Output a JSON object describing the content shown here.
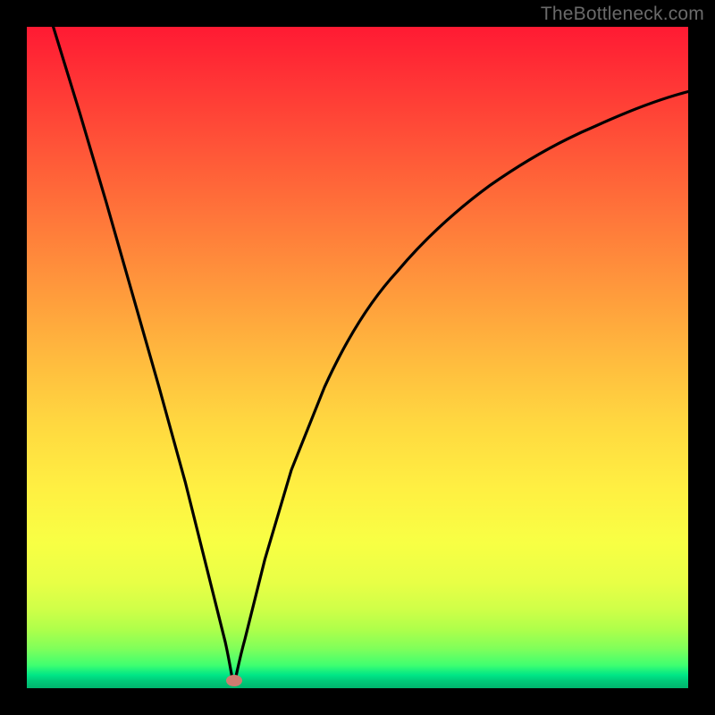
{
  "watermark": "TheBottleneck.com",
  "colors": {
    "background": "#000000",
    "gradient_top": "#ff1a33",
    "gradient_bottom": "#00b46e",
    "curve": "#000000",
    "dot": "#cf7b70"
  },
  "dot": {
    "x_frac": 0.313,
    "y_frac": 0.989
  },
  "chart_data": {
    "type": "line",
    "title": "",
    "xlabel": "",
    "ylabel": "",
    "xlim": [
      0,
      1
    ],
    "ylim": [
      0,
      1
    ],
    "note": "Axes are unlabeled; x and y values are normalized fractions of the plot area. y=1 is the top of the gradient (red), y=0 is the bottom (green). The curve is a V-shaped dip reaching ~0 near x≈0.31.",
    "series": [
      {
        "name": "curve",
        "x": [
          0.04,
          0.08,
          0.12,
          0.16,
          0.2,
          0.24,
          0.28,
          0.3,
          0.313,
          0.33,
          0.36,
          0.4,
          0.45,
          0.5,
          0.56,
          0.62,
          0.7,
          0.78,
          0.86,
          0.94,
          1.0
        ],
        "y": [
          1.0,
          0.87,
          0.735,
          0.595,
          0.455,
          0.31,
          0.15,
          0.07,
          0.005,
          0.075,
          0.195,
          0.33,
          0.455,
          0.545,
          0.63,
          0.695,
          0.76,
          0.81,
          0.85,
          0.882,
          0.902
        ]
      }
    ],
    "marker": {
      "name": "minimum-dot",
      "x": 0.313,
      "y": 0.011
    }
  }
}
